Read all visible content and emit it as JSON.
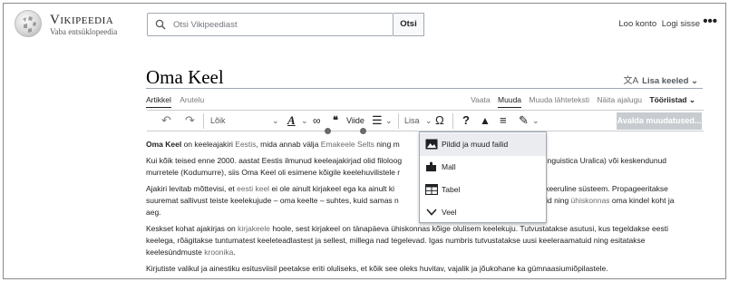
{
  "header": {
    "wordmark": "Vikipeedia",
    "tagline": "Vaba entsüklopeedia",
    "search_placeholder": "Otsi Vikipeediast",
    "search_button": "Otsi",
    "create_account": "Loo konto",
    "log_in": "Logi sisse",
    "more_menu": "•••"
  },
  "page": {
    "title": "Oma Keel",
    "languages_label": "Lisa keeled",
    "languages_icon_glyph": "文A"
  },
  "tabs": {
    "left": [
      "Artikkel",
      "Arutelu"
    ],
    "right": [
      "Vaata",
      "Muuda",
      "Muuda lähteteksti",
      "Näita ajalugu"
    ],
    "tools": "Tööriistad"
  },
  "toolbar": {
    "undo": "↶",
    "redo": "↷",
    "paragraph": "Lõik",
    "text_style": "A",
    "link": "⊖",
    "cite": "Viide",
    "cite_glyph": "❝",
    "list": "☰",
    "insert": "Lisa",
    "special_char": "Ω",
    "help": "?",
    "notices": "▲",
    "page_options": "≡",
    "edit_mode": "✎",
    "publish": "Avalda muudatused..."
  },
  "insert_menu": {
    "items": [
      {
        "label": "Pildid ja muud failid",
        "icon": "image-icon"
      },
      {
        "label": "Mall",
        "icon": "puzzle-icon"
      },
      {
        "label": "Tabel",
        "icon": "table-icon"
      },
      {
        "label": "Veel",
        "icon": "chevron-down-icon"
      }
    ]
  },
  "article": {
    "p1": {
      "bold": "Oma Keel",
      "t1": " on keeleajakiri ",
      "l1": "Eestis",
      "t2": ", mida annab välja ",
      "l2": "Emakeele Selts",
      "t3": " ning m"
    },
    "p2": {
      "t1": "Kui kõik teised enne 2000. aastat Eestis ilmunud keeleajakirjad olid filoloog",
      "t2": "s, Linguistica Uralica) või keskendunud",
      "t3": "murretele (Kodumurre), siis Oma Keel oli esimene kõigile keelehuvilistele r"
    },
    "p3": {
      "t1": "Ajakiri levitab mõttevisi, et ",
      "l1": "eesti keel",
      "t2": " ei ole ainult kirjakeel ega ka ainult ki",
      "t3": "ujude keeruline süsteem. Propageeritakse",
      "t4": "suuremat sallivust teiste keelekujude – oma keelte – suhtes, kuid samas n",
      "t5": "normid ning ",
      "l2": "ühiskonnas",
      "t6": " oma kindel koht ja",
      "t7": "aeg."
    },
    "p4": {
      "t1": "Keskset kohat ajakirjas on ",
      "l1": "kirjakeele",
      "t2": " hoole, sest kirjakeel on tänapäeva ühiskonnas kõige olulisem keelekuju. Tutvustatakse asutusi, kus tegeldakse eesti",
      "t3": "keelega, rõägitakse tuntumatest keeleteadlastest ja sellest, millega nad tegelevad. Igas numbris tutvustatakse uusi keeleraamatuid ning esitatakse",
      "t4": "keelesündmuste ",
      "l2": "kroonika",
      "t5": "."
    },
    "p5": "Kirjutiste valikul ja ainestiku esitusviisil peetakse eriti oluliseks, et kõik see oleks huvitav, vajalik ja jõukohane ka gümnaasiumiõpilastele."
  }
}
